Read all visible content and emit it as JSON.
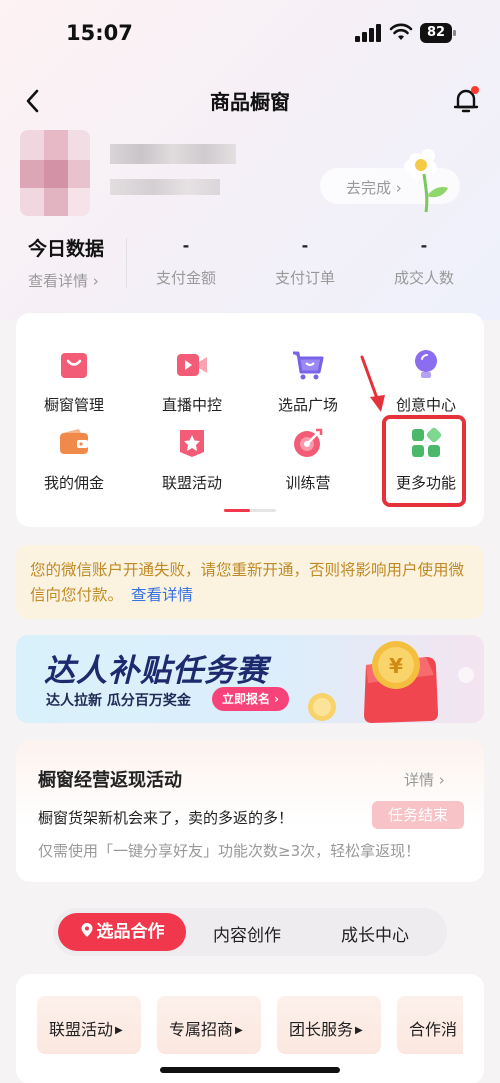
{
  "status_bar": {
    "time": "15:07",
    "battery": "82"
  },
  "nav": {
    "title": "商品橱窗"
  },
  "profile": {
    "complete_link": "去完成 ›"
  },
  "stats": {
    "today_title": "今日数据",
    "detail_link": "查看详情 ›",
    "columns": [
      {
        "value": "-",
        "label": "支付金额"
      },
      {
        "value": "-",
        "label": "支付订单"
      },
      {
        "value": "-",
        "label": "成交人数"
      }
    ]
  },
  "tools": [
    {
      "label": "橱窗管理",
      "icon": "bag-icon"
    },
    {
      "label": "直播中控",
      "icon": "video-camera-icon"
    },
    {
      "label": "选品广场",
      "icon": "cart-icon"
    },
    {
      "label": "创意中心",
      "icon": "lightbulb-icon"
    },
    {
      "label": "我的佣金",
      "icon": "wallet-icon"
    },
    {
      "label": "联盟活动",
      "icon": "star-badge-icon"
    },
    {
      "label": "训练营",
      "icon": "target-icon"
    },
    {
      "label": "更多功能",
      "icon": "grid-icon"
    }
  ],
  "notice": {
    "text": "您的微信账户开通失败，请您重新开通，否则将影响用户使用微信向您付款。",
    "link": "查看详情"
  },
  "banner": {
    "title": "达人补贴任务赛",
    "subtitle": "达人拉新 瓜分百万奖金",
    "button": "立即报名 ›"
  },
  "promo": {
    "title": "橱窗经营返现活动",
    "detail": "详情 ›",
    "line1": "橱窗货架新机会来了，卖的多返的多！",
    "badge": "任务结束",
    "line2": "仅需使用「一键分享好友」功能次数≥3次，轻松拿返现！"
  },
  "segment": {
    "active": "选品合作",
    "items": [
      "内容创作",
      "成长中心"
    ]
  },
  "chips": [
    "联盟活动",
    "专属招商",
    "团长服务",
    "合作消"
  ],
  "colors": {
    "accent": "#f0374b",
    "highlight": "#e5323a",
    "notice_text": "#c08a26",
    "link": "#3872e0"
  }
}
